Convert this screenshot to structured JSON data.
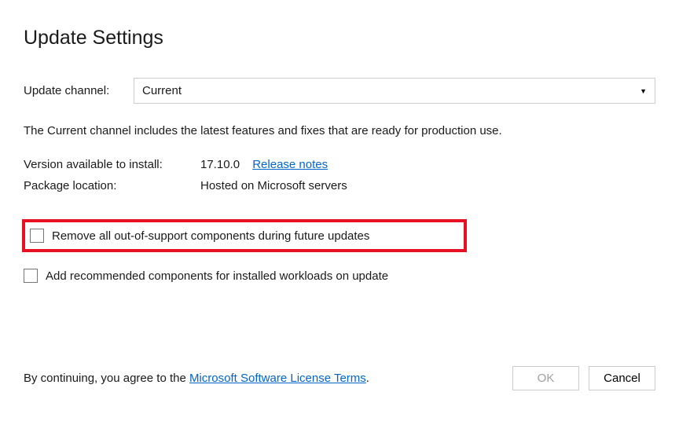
{
  "title": "Update Settings",
  "channel": {
    "label": "Update channel:",
    "selected": "Current"
  },
  "description": "The Current channel includes the latest features and fixes that are ready for production use.",
  "version": {
    "label": "Version available to install:",
    "value": "17.10.0",
    "release_notes": "Release notes"
  },
  "package": {
    "label": "Package location:",
    "value": "Hosted on Microsoft servers"
  },
  "checkboxes": {
    "remove_out_of_support": "Remove all out-of-support components during future updates",
    "add_recommended": "Add recommended components for installed workloads on update"
  },
  "footer": {
    "prefix": "By continuing, you agree to the ",
    "link": "Microsoft Software License Terms",
    "suffix": "."
  },
  "buttons": {
    "ok": "OK",
    "cancel": "Cancel"
  }
}
